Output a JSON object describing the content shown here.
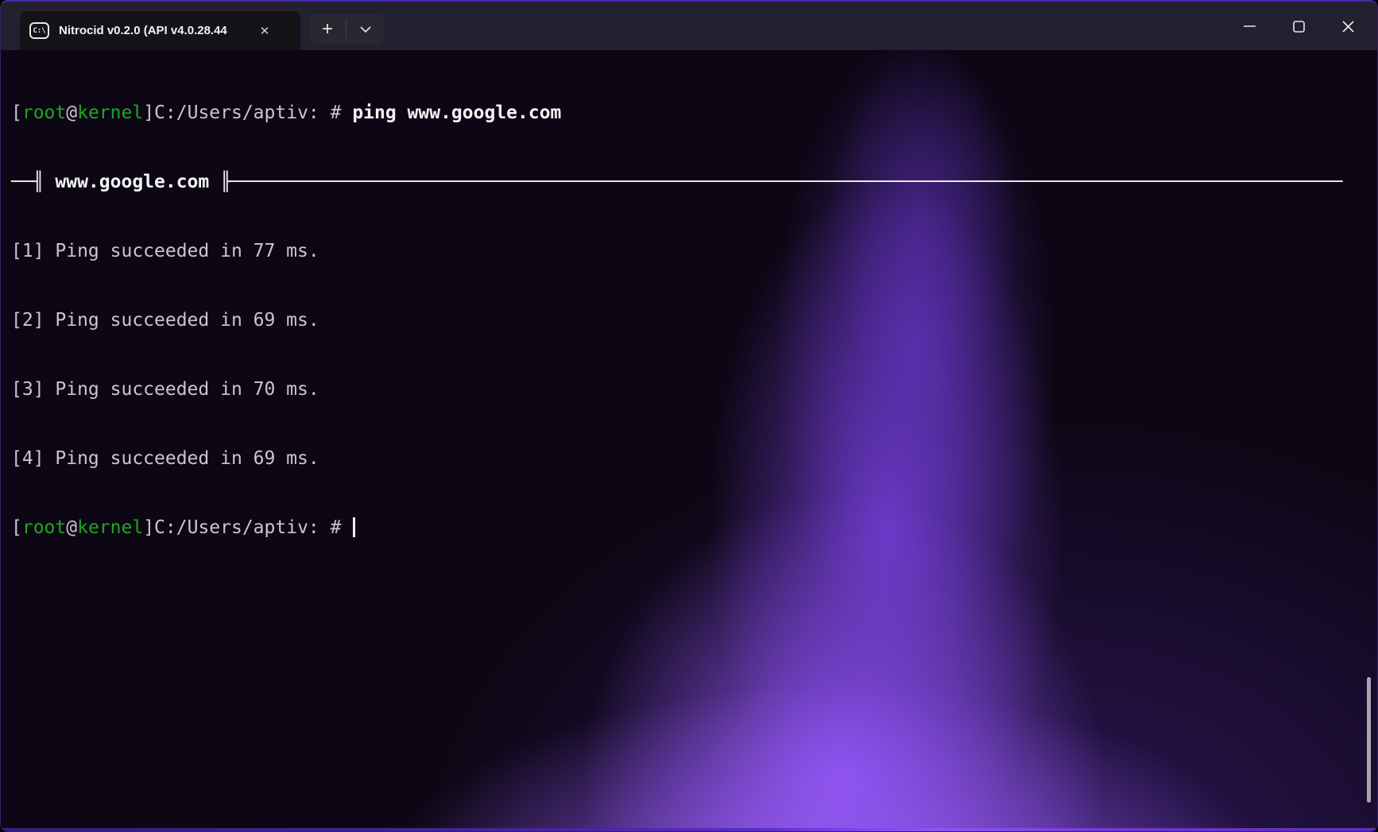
{
  "colors": {
    "accent_purple": "#8a4df5",
    "border_purple": "#4d28b4",
    "terminal_green": "#1ca81e",
    "terminal_text": "#c8c8c8",
    "terminal_bright": "#f2f2f2",
    "titlebar_bg": "#232030",
    "tab_bg": "#151318"
  },
  "titlebar": {
    "tab": {
      "title": "Nitrocid v0.2.0 (API v4.0.28.44",
      "icon_label": "C:\\",
      "close_glyph": "✕"
    },
    "new_tab_glyph": "+",
    "icons": {
      "tab_icon": "command-prompt-icon",
      "dropdown": "chevron-down-icon",
      "minimize": "minimize-icon",
      "maximize": "maximize-icon",
      "close": "close-icon"
    }
  },
  "terminal": {
    "prompt": {
      "bracket_open": "[",
      "user": "root",
      "at": "@",
      "host": "kernel",
      "rest": "]C:/Users/aptiv: # ",
      "command": "ping www.google.com"
    },
    "separator": {
      "left": "──╢ ",
      "title": "www.google.com",
      "right": " ╟─────────────────────────────────────────────────────────────────────────────────────────────────────"
    },
    "ping_lines": [
      "[1] Ping succeeded in 77 ms.",
      "[2] Ping succeeded in 69 ms.",
      "[3] Ping succeeded in 70 ms.",
      "[4] Ping succeeded in 69 ms."
    ],
    "ping_values_ms": [
      77,
      69,
      70,
      69
    ]
  }
}
